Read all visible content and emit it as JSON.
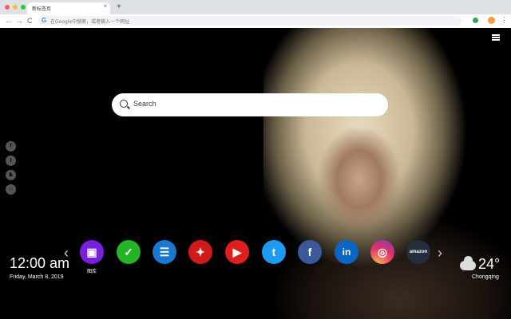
{
  "browser": {
    "tab_title": "新标签页",
    "tab_close": "×",
    "new_tab": "+",
    "back": "←",
    "forward": "→",
    "reload": "C",
    "omnibox_placeholder": "在Google中搜索，或者输入一个网址",
    "menu": "⋮"
  },
  "search": {
    "placeholder": "Search"
  },
  "social": [
    "f",
    "t",
    "♞",
    "☺"
  ],
  "apps": [
    {
      "name": "gallery",
      "label": "图库",
      "glyph": "▣",
      "color": "#7a1ee0"
    },
    {
      "name": "tasks",
      "label": "",
      "glyph": "✓",
      "color": "#23b527"
    },
    {
      "name": "notes",
      "label": "",
      "glyph": "☰",
      "color": "#1a78d0"
    },
    {
      "name": "game",
      "label": "",
      "glyph": "✦",
      "color": "#d11a1a"
    },
    {
      "name": "youtube",
      "label": "",
      "glyph": "▶",
      "color": "#e01e1e"
    },
    {
      "name": "twitter",
      "label": "",
      "glyph": "t",
      "color": "#1d9bf0"
    },
    {
      "name": "facebook",
      "label": "",
      "glyph": "f",
      "color": "#3b5998"
    },
    {
      "name": "linkedin",
      "label": "",
      "glyph": "in",
      "color": "#0a66c2"
    },
    {
      "name": "instagram",
      "label": "",
      "glyph": "◎",
      "color": "#d62f7a"
    },
    {
      "name": "amazon",
      "label": "",
      "glyph": "amazon",
      "color": "#232f3e"
    }
  ],
  "nav": {
    "prev": "‹",
    "next": "›"
  },
  "clock": {
    "time": "12:00 am",
    "date": "Friday, March 8, 2019"
  },
  "weather": {
    "temp": "24°",
    "city": "Chongqing",
    "condition": "cloudy-icon"
  }
}
